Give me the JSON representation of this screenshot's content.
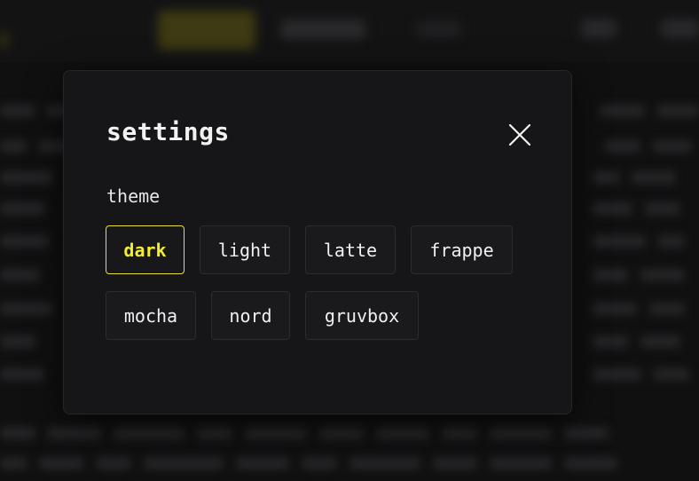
{
  "modal": {
    "title": "settings",
    "close_icon": "close-icon"
  },
  "theme_section": {
    "label": "theme",
    "selected": "dark",
    "options": [
      {
        "label": "dark",
        "active": true
      },
      {
        "label": "light",
        "active": false
      },
      {
        "label": "latte",
        "active": false
      },
      {
        "label": "frappe",
        "active": false
      },
      {
        "label": "mocha",
        "active": false
      },
      {
        "label": "nord",
        "active": false
      },
      {
        "label": "gruvbox",
        "active": false
      }
    ]
  },
  "colors": {
    "accent": "#f5ee2e",
    "modal_bg": "#161618",
    "page_bg": "#101011"
  }
}
